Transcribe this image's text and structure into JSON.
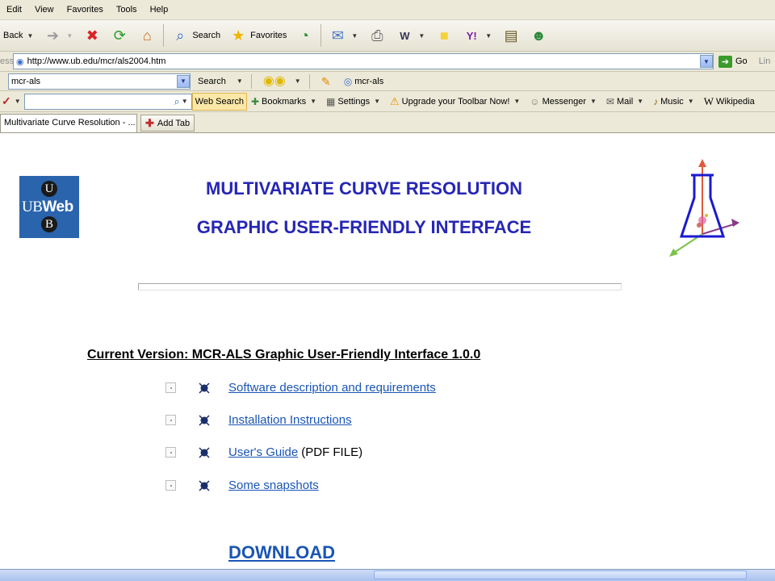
{
  "menu": [
    "Edit",
    "View",
    "Favorites",
    "Tools",
    "Help"
  ],
  "toolbar": {
    "back_label": "Back",
    "search_label": "Search",
    "favorites_label": "Favorites"
  },
  "address": {
    "label_fragment": "ess",
    "url": "http://www.ub.edu/mcr/als2004.htm",
    "go_label": "Go",
    "links_fragment": "Lin"
  },
  "google": {
    "query": "mcr-als",
    "search_label": "Search",
    "highlight_label": "mcr-als"
  },
  "yahoo": {
    "web_search_label": "Web Search",
    "items": [
      "Bookmarks",
      "Settings",
      "Upgrade your Toolbar Now!",
      "Messenger",
      "Mail",
      "Music",
      "Wikipedia"
    ]
  },
  "tabs": {
    "active_title": "Multivariate Curve Resolution - ...",
    "add_label": "Add Tab"
  },
  "page": {
    "logo": {
      "top_letter": "U",
      "word_plain": "UB",
      "word_bold": "Web",
      "bottom_letter": "B"
    },
    "title_line1": "MULTIVARIATE CURVE RESOLUTION",
    "title_line2": "GRAPHIC USER-FRIENDLY INTERFACE",
    "version_heading": "Current Version: MCR-ALS Graphic User-Friendly Interface 1.0.0",
    "items": [
      {
        "link": "Software description and requirements",
        "suffix": ""
      },
      {
        "link": "Installation Instructions",
        "suffix": ""
      },
      {
        "link": "User's Guide",
        "suffix": "(PDF FILE)"
      },
      {
        "link": "Some snapshots",
        "suffix": ""
      }
    ],
    "download_label": "DOWNLOAD"
  },
  "colors": {
    "title": "#2626b5",
    "link": "#1a55b5",
    "logo_bg": "#2a64ad"
  }
}
